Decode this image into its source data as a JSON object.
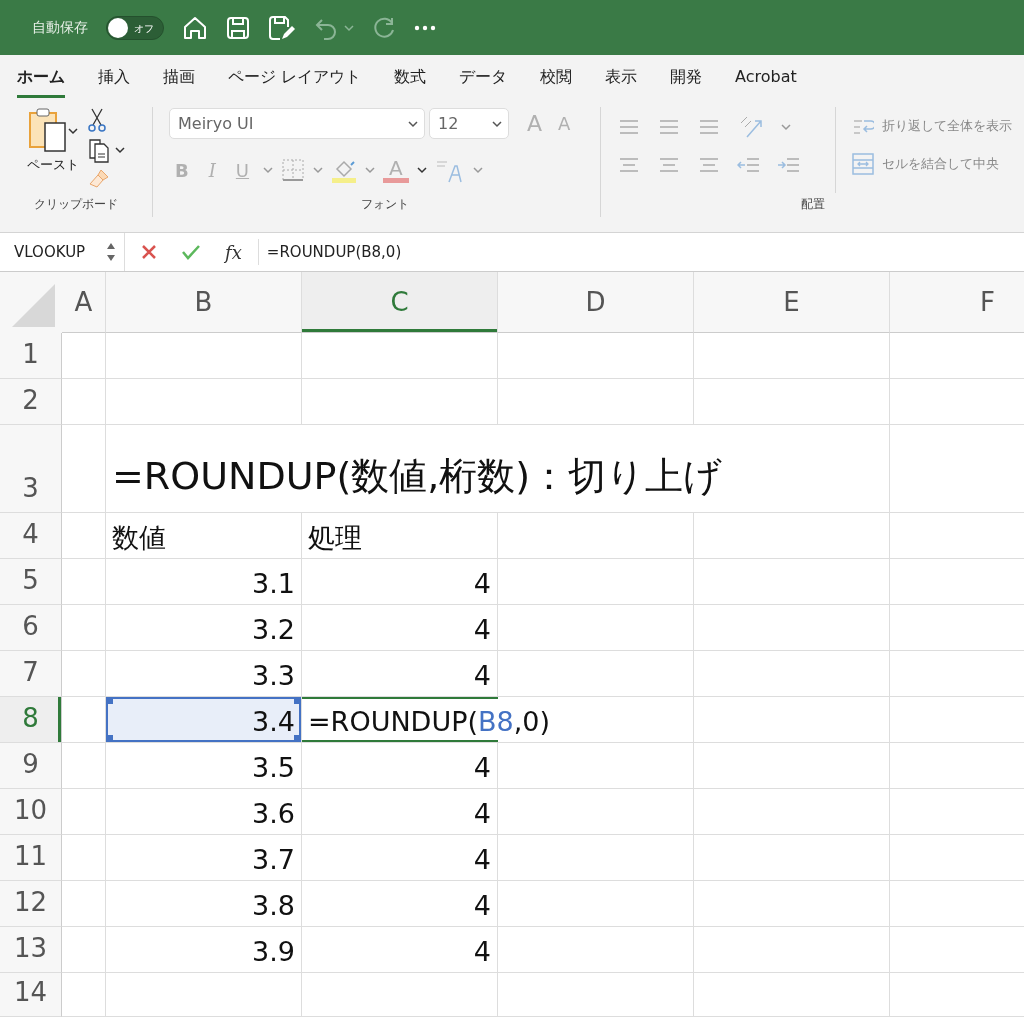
{
  "title_bar": {
    "autosave_label": "自動保存",
    "autosave": {
      "label": "オフ",
      "on": false
    }
  },
  "ribbon_tabs": [
    {
      "label": "ホーム",
      "selected": true
    },
    {
      "label": "挿入",
      "selected": false
    },
    {
      "label": "描画",
      "selected": false
    },
    {
      "label": "ページ レイアウト",
      "selected": false
    },
    {
      "label": "数式",
      "selected": false
    },
    {
      "label": "データ",
      "selected": false
    },
    {
      "label": "校閲",
      "selected": false
    },
    {
      "label": "表示",
      "selected": false
    },
    {
      "label": "開発",
      "selected": false
    },
    {
      "label": "Acrobat",
      "selected": false
    }
  ],
  "clipboard": {
    "paste_label": "ペースト",
    "group_label": "クリップボード"
  },
  "font": {
    "name": "Meiryo UI",
    "size": "12",
    "grow_label": "A",
    "shrink_label": "A",
    "bold_label": "B",
    "italic_label": "I",
    "underline_label": "U",
    "color_label": "A",
    "group_label": "フォント"
  },
  "alignment": {
    "wrap_text": "折り返して全体を表示",
    "merge": "セルを結合して中央",
    "group_label": "配置"
  },
  "formula_bar": {
    "name_box": "VLOOKUP",
    "fx_label": "fx",
    "formula": "=ROUNDUP(B8,0)"
  },
  "sheet": {
    "columns": [
      {
        "label": "A",
        "selected": false
      },
      {
        "label": "B",
        "selected": false
      },
      {
        "label": "C",
        "selected": true
      },
      {
        "label": "D",
        "selected": false
      },
      {
        "label": "E",
        "selected": false
      },
      {
        "label": "F",
        "selected": false
      }
    ],
    "rows": [
      {
        "number": "1",
        "selected": false
      },
      {
        "number": "2",
        "selected": false
      },
      {
        "number": "3",
        "selected": false,
        "cell_b": {
          "kind": "title",
          "text": "=ROUNDUP(数値,桁数)：切り上げ",
          "selected": false
        }
      },
      {
        "number": "4",
        "selected": false,
        "cell_b": {
          "kind": "text",
          "text": "数値",
          "selected": false
        },
        "cell_c": {
          "kind": "text",
          "text": "処理",
          "selected": false
        }
      },
      {
        "number": "5",
        "selected": false,
        "cell_b": {
          "kind": "number",
          "text": "3.1",
          "selected": false
        },
        "cell_c": {
          "kind": "number",
          "text": "4",
          "selected": false
        }
      },
      {
        "number": "6",
        "selected": false,
        "cell_b": {
          "kind": "number",
          "text": "3.2",
          "selected": false
        },
        "cell_c": {
          "kind": "number",
          "text": "4",
          "selected": false
        }
      },
      {
        "number": "7",
        "selected": false,
        "cell_b": {
          "kind": "number",
          "text": "3.3",
          "selected": false
        },
        "cell_c": {
          "kind": "number",
          "text": "4",
          "selected": false
        }
      },
      {
        "number": "8",
        "selected": true,
        "cell_b": {
          "kind": "number",
          "text": "3.4",
          "selected": true
        },
        "cell_c": {
          "kind": "formula",
          "selected": false,
          "parts": [
            {
              "text": "=ROUNDUP(",
              "ref": false
            },
            {
              "text": "B8",
              "ref": true
            },
            {
              "text": ",0)",
              "ref": false
            }
          ]
        }
      },
      {
        "number": "9",
        "selected": false,
        "cell_b": {
          "kind": "number",
          "text": "3.5",
          "selected": false
        },
        "cell_c": {
          "kind": "number",
          "text": "4",
          "selected": false
        }
      },
      {
        "number": "10",
        "selected": false,
        "cell_b": {
          "kind": "number",
          "text": "3.6",
          "selected": false
        },
        "cell_c": {
          "kind": "number",
          "text": "4",
          "selected": false
        }
      },
      {
        "number": "11",
        "selected": false,
        "cell_b": {
          "kind": "number",
          "text": "3.7",
          "selected": false
        },
        "cell_c": {
          "kind": "number",
          "text": "4",
          "selected": false
        }
      },
      {
        "number": "12",
        "selected": false,
        "cell_b": {
          "kind": "number",
          "text": "3.8",
          "selected": false
        },
        "cell_c": {
          "kind": "number",
          "text": "4",
          "selected": false
        }
      },
      {
        "number": "13",
        "selected": false,
        "cell_b": {
          "kind": "number",
          "text": "3.9",
          "selected": false
        },
        "cell_c": {
          "kind": "number",
          "text": "4",
          "selected": false
        }
      },
      {
        "number": "14",
        "selected": false
      }
    ]
  }
}
